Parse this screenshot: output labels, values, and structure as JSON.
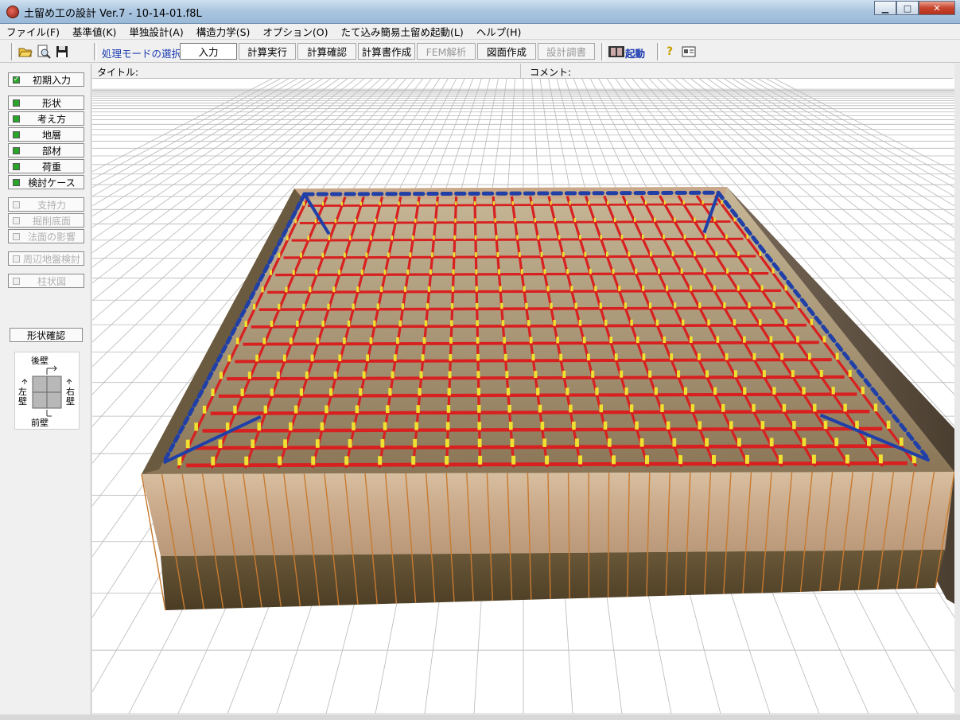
{
  "window": {
    "title": "土留め工の設計 Ver.7 - 10-14-01.f8L",
    "controls": [
      "minimize",
      "maximize",
      "close"
    ]
  },
  "menu": [
    "ファイル(F)",
    "基準値(K)",
    "単独設計(A)",
    "構造力学(S)",
    "オプション(O)",
    "たて込み簡易土留め起動(L)",
    "ヘルプ(H)"
  ],
  "toolbar": {
    "icons": [
      "open-folder-icon",
      "preview-icon",
      "save-icon"
    ],
    "mode_label": "処理モードの選択",
    "modes": [
      {
        "label": "入力",
        "state": "active"
      },
      {
        "label": "計算実行",
        "state": "enabled"
      },
      {
        "label": "計算確認",
        "state": "enabled"
      },
      {
        "label": "計算書作成",
        "state": "enabled"
      },
      {
        "label": "FEM解析",
        "state": "disabled"
      },
      {
        "label": "図面作成",
        "state": "enabled"
      },
      {
        "label": "設計調書",
        "state": "disabled"
      }
    ],
    "launch_label": "起動",
    "help_glyph": "?"
  },
  "header": {
    "title_label": "タイトル:",
    "comment_label": "コメント:"
  },
  "sidebar": {
    "initial": {
      "label": "初期入力",
      "checked": true
    },
    "groups": [
      {
        "label": "形状",
        "enabled": true
      },
      {
        "label": "考え方",
        "enabled": true
      },
      {
        "label": "地層",
        "enabled": true
      },
      {
        "label": "部材",
        "enabled": true
      },
      {
        "label": "荷重",
        "enabled": true
      },
      {
        "label": "検討ケース",
        "enabled": true
      },
      {
        "label": "支持力",
        "enabled": false
      },
      {
        "label": "掘削底面",
        "enabled": false
      },
      {
        "label": "法面の影響",
        "enabled": false
      },
      {
        "label": "周辺地盤検討",
        "enabled": false
      },
      {
        "label": "柱状図",
        "enabled": false
      }
    ],
    "shape_check_label": "形状確認",
    "compass": {
      "back": "後壁",
      "left": "左\n壁",
      "right": "右\n壁",
      "front": "前壁"
    }
  },
  "colors": {
    "accent_text": "#1a3ab0",
    "lamp_green": "#2aa52a",
    "strut_red": "#d82020",
    "waler_blue": "#2040a8",
    "post_yellow": "#f0e030",
    "soil_upper": "#c8a888",
    "soil_lower": "#5a4a30",
    "pile_orange": "#c87a30"
  }
}
